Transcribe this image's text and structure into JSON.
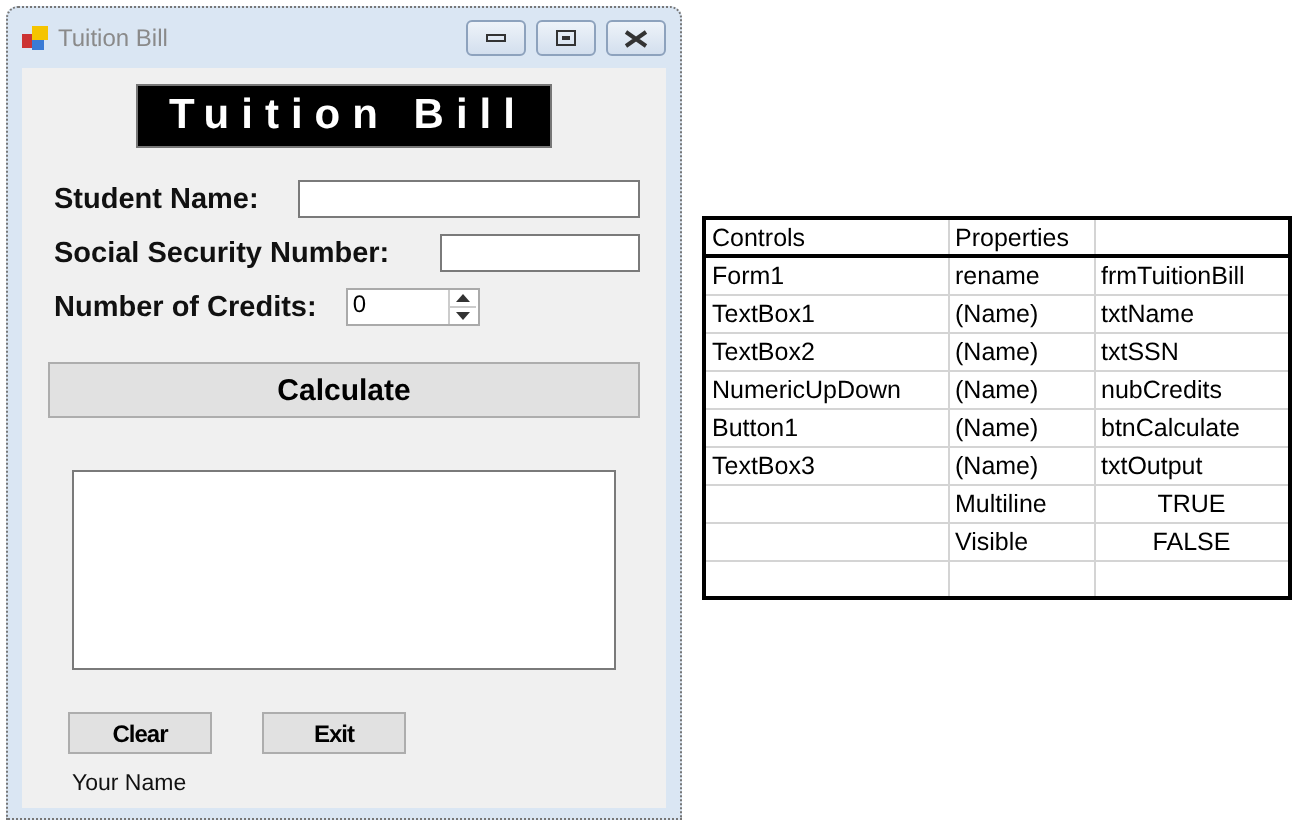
{
  "window": {
    "title": "Tuition Bill"
  },
  "form": {
    "banner": "Tuition Bill",
    "fields": [
      {
        "label": "Student Name:",
        "kind": "text"
      },
      {
        "label": "Social Security Number:",
        "kind": "text"
      },
      {
        "label": "Number of Credits:",
        "kind": "numeric",
        "value": "0"
      }
    ],
    "calculate_button": "Calculate",
    "buttons": [
      "Clear",
      "Exit"
    ],
    "footer": "Your Name"
  },
  "table": {
    "columns": [
      "Controls",
      "Properties"
    ],
    "rows": [
      {
        "cells": [
          "Form1",
          "rename",
          "frmTuitionBill"
        ],
        "kind": "name"
      },
      {
        "cells": [
          "TextBox1",
          "(Name)",
          "txtName"
        ],
        "kind": "name"
      },
      {
        "cells": [
          "TextBox2",
          "(Name)",
          "txtSSN"
        ],
        "kind": "name"
      },
      {
        "cells": [
          "NumericUpDown",
          "(Name)",
          "nubCredits"
        ],
        "kind": "name"
      },
      {
        "cells": [
          "Button1",
          "(Name)",
          "btnCalculate"
        ],
        "kind": "name"
      },
      {
        "cells": [
          "TextBox3",
          "(Name)",
          "txtOutput"
        ],
        "kind": "name"
      },
      {
        "cells": [
          null,
          "Multiline",
          "TRUE"
        ],
        "kind": "flag"
      },
      {
        "cells": [
          null,
          "Visible",
          "FALSE"
        ],
        "kind": "flag"
      }
    ]
  }
}
